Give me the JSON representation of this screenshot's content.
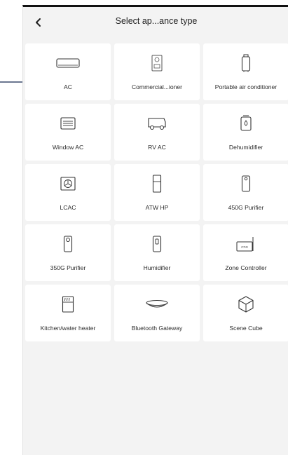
{
  "header": {
    "back_icon": "chevron-left-icon",
    "title": "Select ap...ance type"
  },
  "appliances": [
    {
      "label": "AC",
      "icon": "air-conditioner-icon"
    },
    {
      "label": "Commercial...ioner",
      "icon": "commercial-ac-icon"
    },
    {
      "label": "Portable air conditioner",
      "icon": "portable-ac-icon"
    },
    {
      "label": "Window AC",
      "icon": "window-ac-icon"
    },
    {
      "label": "RV AC",
      "icon": "rv-icon"
    },
    {
      "label": "Dehumidifier",
      "icon": "dehumidifier-icon"
    },
    {
      "label": "LCAC",
      "icon": "lcac-fan-icon"
    },
    {
      "label": "ATW HP",
      "icon": "heat-pump-icon"
    },
    {
      "label": "450G Purifier",
      "icon": "purifier-450g-icon"
    },
    {
      "label": "350G Purifier",
      "icon": "purifier-350g-icon"
    },
    {
      "label": "Humidifier",
      "icon": "humidifier-icon"
    },
    {
      "label": "Zone Controller",
      "icon": "zone-controller-icon"
    },
    {
      "label": "Kitchen/water heater",
      "icon": "water-heater-icon"
    },
    {
      "label": "Bluetooth Gateway",
      "icon": "bluetooth-gateway-icon"
    },
    {
      "label": "Scene Cube",
      "icon": "cube-icon"
    }
  ],
  "zone_controller_icon_text": "ZONE",
  "colors": {
    "background": "#f3f3f3",
    "tile": "#ffffff",
    "text": "#2b2b2b",
    "icon_stroke": "#333333",
    "arrow": "#3a4a6b"
  }
}
